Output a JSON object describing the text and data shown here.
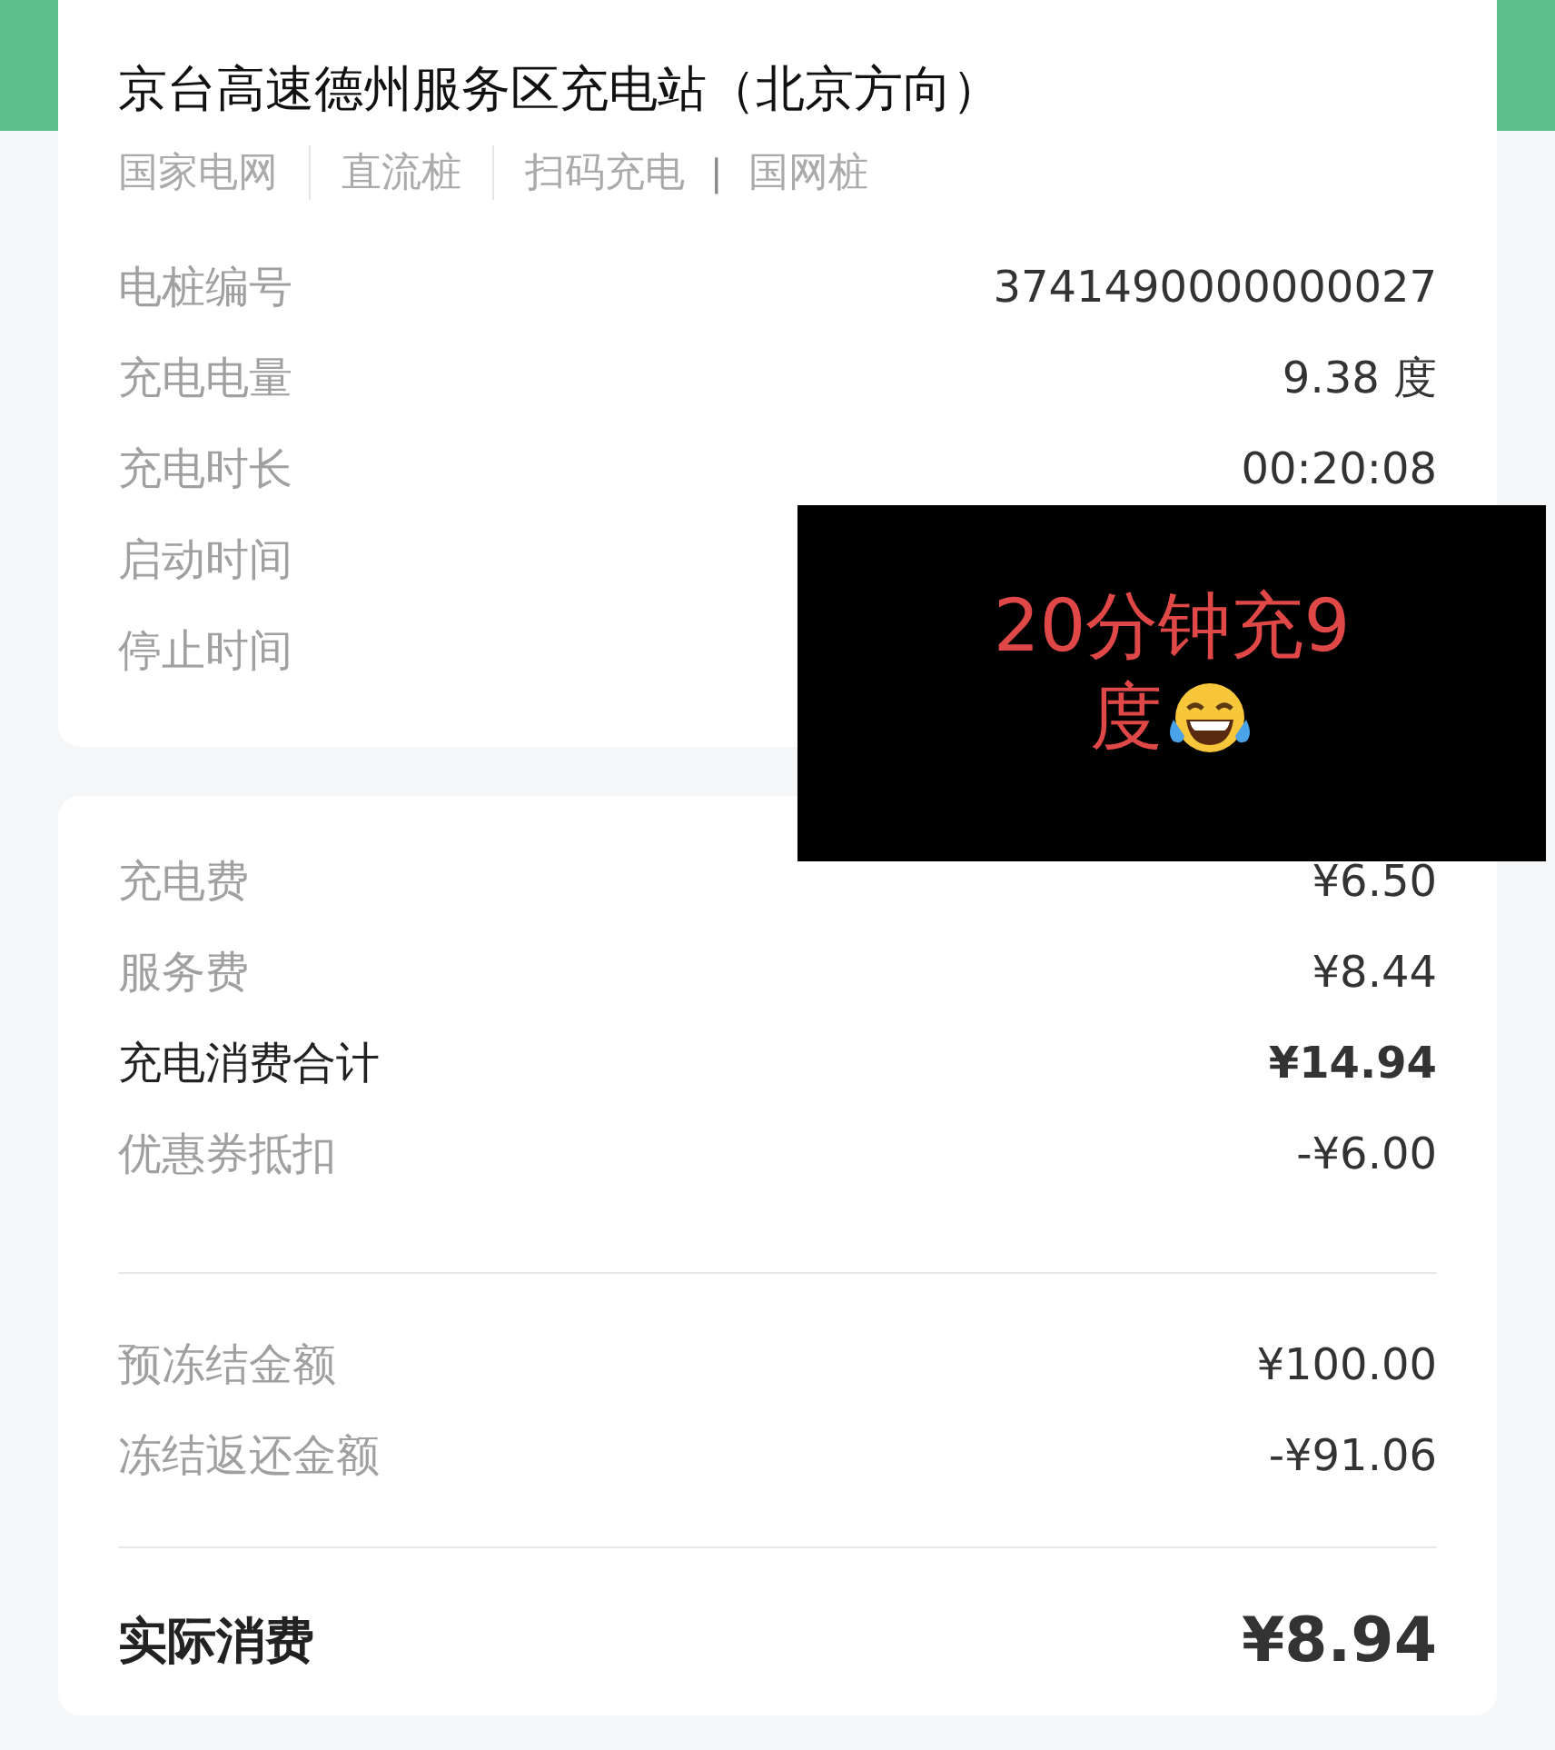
{
  "station": {
    "title": "京台高速德州服务区充电站（北京方向）",
    "tags": [
      {
        "kind": "tag",
        "text": "国家电网"
      },
      {
        "kind": "line"
      },
      {
        "kind": "tag",
        "text": "直流桩"
      },
      {
        "kind": "line"
      },
      {
        "kind": "tag",
        "text": "扫码充电"
      },
      {
        "kind": "pipe",
        "text": "|"
      },
      {
        "kind": "tag",
        "text": "国网桩"
      }
    ],
    "details": [
      {
        "label": "电桩编号",
        "value": "3741490000000027"
      },
      {
        "label": "充电电量",
        "value": "9.38 度"
      },
      {
        "label": "充电时长",
        "value": "00:20:08"
      },
      {
        "label": "启动时间"
      },
      {
        "label": "停止时间"
      }
    ]
  },
  "fees": {
    "groups": [
      [
        {
          "kind": "normal",
          "label": "充电费",
          "value": "¥6.50"
        },
        {
          "kind": "normal",
          "label": "服务费",
          "value": "¥8.44"
        },
        {
          "kind": "emphasis",
          "label": "充电消费合计",
          "value": "¥14.94"
        },
        {
          "kind": "normal",
          "label": "优惠券抵扣",
          "value": "-¥6.00"
        }
      ],
      [
        {
          "kind": "normal",
          "label": "预冻结金额",
          "value": "¥100.00"
        },
        {
          "kind": "normal",
          "label": "冻结返还金额",
          "value": "-¥91.06"
        }
      ],
      [
        {
          "kind": "total",
          "label": "实际消费",
          "value": "¥8.94"
        }
      ]
    ]
  },
  "overlay": {
    "caption_lines": [
      "20分钟充9",
      "度"
    ]
  }
}
